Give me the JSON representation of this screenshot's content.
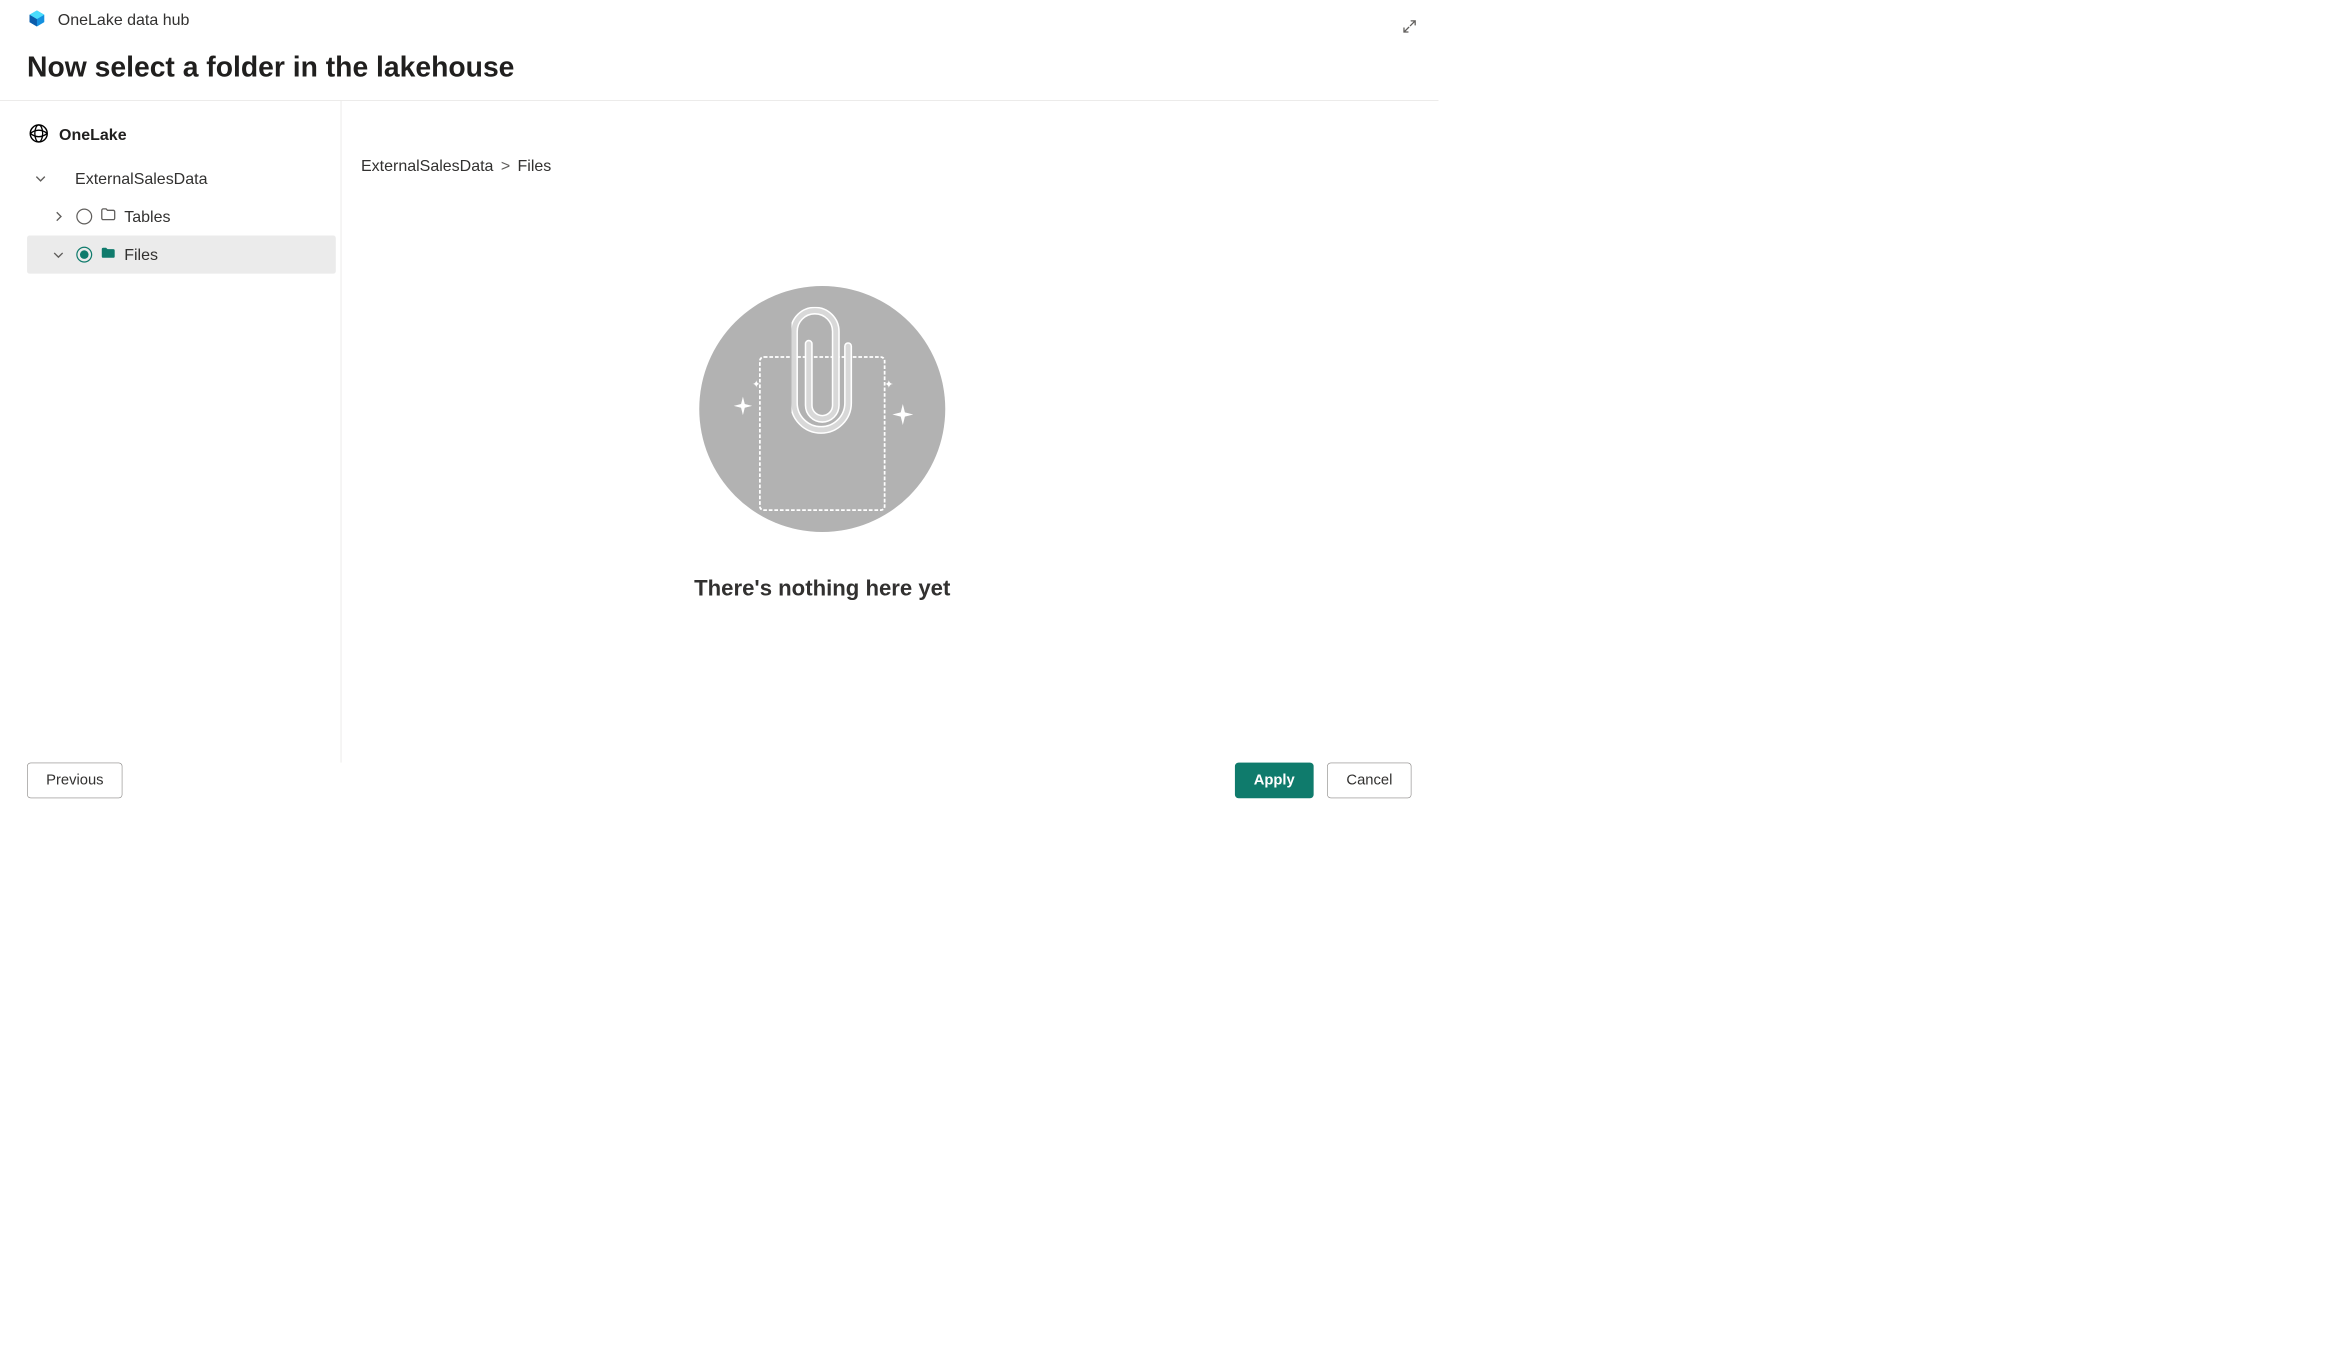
{
  "header": {
    "product": "OneLake data hub",
    "heading": "Now select a folder in the lakehouse"
  },
  "tree": {
    "root_label": "OneLake",
    "lakehouse_label": "ExternalSalesData",
    "tables_label": "Tables",
    "files_label": "Files"
  },
  "breadcrumb": {
    "item0": "ExternalSalesData",
    "item1": "Files"
  },
  "empty_state": {
    "message": "There's nothing here yet"
  },
  "footer": {
    "previous_label": "Previous",
    "apply_label": "Apply",
    "cancel_label": "Cancel"
  }
}
